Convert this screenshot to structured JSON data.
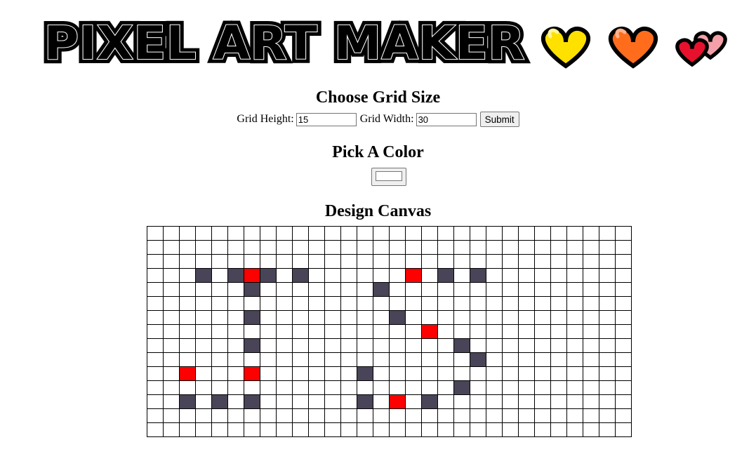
{
  "logo": {
    "text": "PIXEL ART MAKER"
  },
  "hearts": [
    {
      "name": "yellow-heart-icon",
      "fill": "#ffe100",
      "shine": "#fff59a"
    },
    {
      "name": "orange-heart-icon",
      "fill": "#ff6d1c",
      "shine": "#ffb28c"
    }
  ],
  "two_hearts": {
    "front": "#e8112d",
    "back": "#f4a0a8"
  },
  "grid_size": {
    "title": "Choose Grid Size",
    "height_label": "Grid Height:",
    "height_value": "15",
    "width_label": "Grid Width:",
    "width_value": "30",
    "submit_label": "Submit"
  },
  "color": {
    "title": "Pick A Color",
    "value": "#ffffff"
  },
  "canvas": {
    "title": "Design Canvas",
    "rows": 15,
    "cols": 30,
    "palette": {
      "dark": "#4a4458",
      "red": "#ff0000"
    },
    "painted": [
      {
        "row": 3,
        "col": 3,
        "color": "dark"
      },
      {
        "row": 3,
        "col": 5,
        "color": "dark"
      },
      {
        "row": 3,
        "col": 6,
        "color": "red"
      },
      {
        "row": 3,
        "col": 7,
        "color": "dark"
      },
      {
        "row": 3,
        "col": 9,
        "color": "dark"
      },
      {
        "row": 3,
        "col": 16,
        "color": "red"
      },
      {
        "row": 3,
        "col": 18,
        "color": "dark"
      },
      {
        "row": 3,
        "col": 20,
        "color": "dark"
      },
      {
        "row": 4,
        "col": 6,
        "color": "dark"
      },
      {
        "row": 4,
        "col": 14,
        "color": "dark"
      },
      {
        "row": 6,
        "col": 6,
        "color": "dark"
      },
      {
        "row": 6,
        "col": 15,
        "color": "dark"
      },
      {
        "row": 7,
        "col": 17,
        "color": "red"
      },
      {
        "row": 8,
        "col": 6,
        "color": "dark"
      },
      {
        "row": 8,
        "col": 19,
        "color": "dark"
      },
      {
        "row": 9,
        "col": 20,
        "color": "dark"
      },
      {
        "row": 10,
        "col": 2,
        "color": "red"
      },
      {
        "row": 10,
        "col": 6,
        "color": "red"
      },
      {
        "row": 10,
        "col": 13,
        "color": "dark"
      },
      {
        "row": 11,
        "col": 19,
        "color": "dark"
      },
      {
        "row": 12,
        "col": 2,
        "color": "dark"
      },
      {
        "row": 12,
        "col": 4,
        "color": "dark"
      },
      {
        "row": 12,
        "col": 6,
        "color": "dark"
      },
      {
        "row": 12,
        "col": 13,
        "color": "dark"
      },
      {
        "row": 12,
        "col": 15,
        "color": "red"
      },
      {
        "row": 12,
        "col": 17,
        "color": "dark"
      }
    ]
  }
}
